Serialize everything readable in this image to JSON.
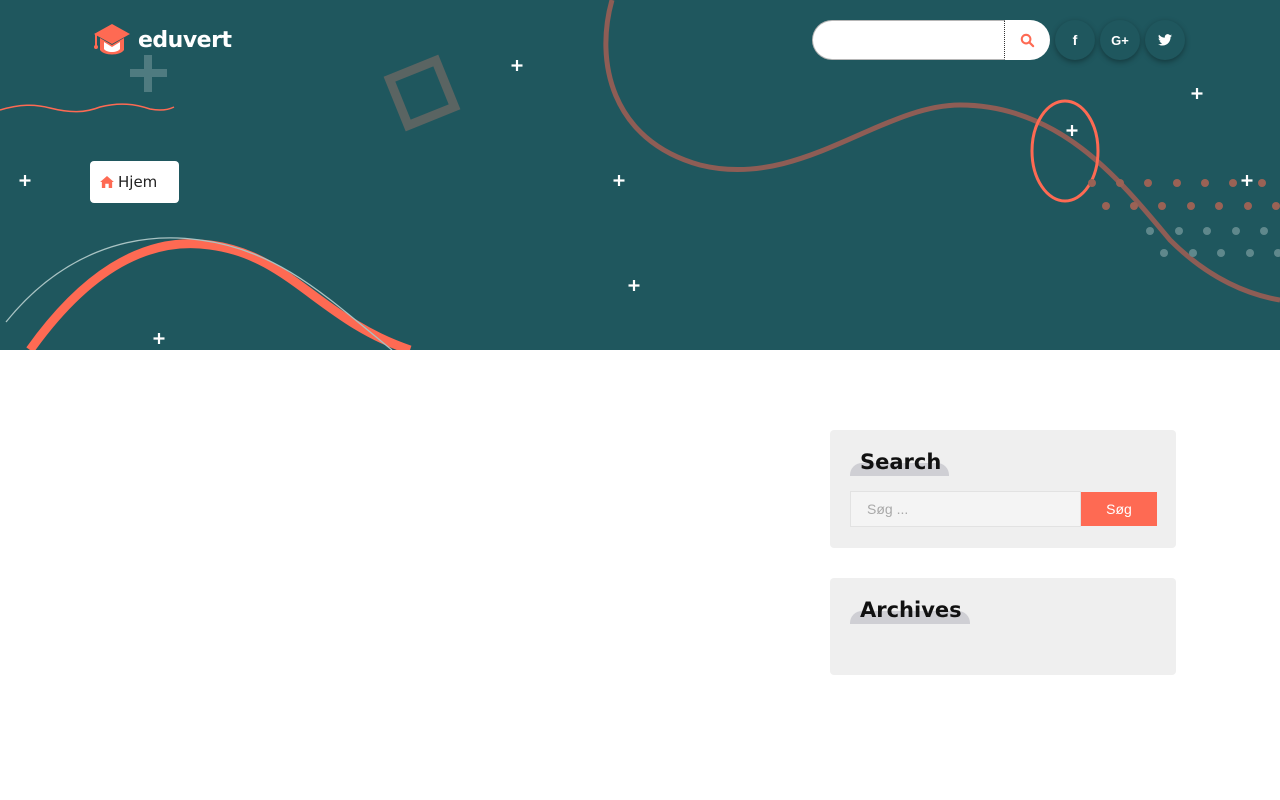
{
  "brand": {
    "name": "eduvert"
  },
  "header": {
    "search": {
      "value": "",
      "placeholder": ""
    },
    "social": [
      {
        "label": "f",
        "icon": "facebook-icon"
      },
      {
        "label": "G+",
        "icon": "google-plus-icon"
      },
      {
        "label": "",
        "icon": "twitter-icon"
      }
    ]
  },
  "breadcrumb": {
    "home_label": "Hjem",
    "icon": "home-icon"
  },
  "sidebar": {
    "search_widget": {
      "title": "Search",
      "placeholder": "Søg ...",
      "button_label": "Søg"
    },
    "archives_widget": {
      "title": "Archives"
    }
  },
  "colors": {
    "hero_bg": "#1f575e",
    "accent": "#fe6a53",
    "widget_bg": "#efefef"
  }
}
